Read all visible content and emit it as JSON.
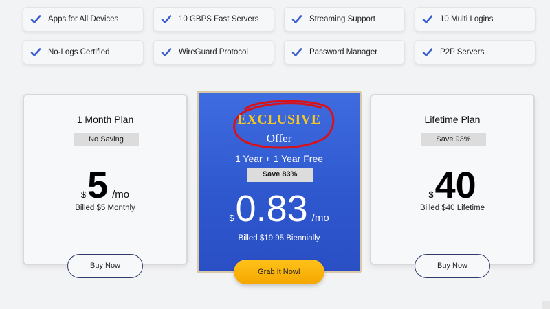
{
  "features": [
    {
      "label": "Apps for All Devices"
    },
    {
      "label": "10 GBPS Fast Servers"
    },
    {
      "label": "Streaming Support"
    },
    {
      "label": "10 Multi Logins"
    },
    {
      "label": "No-Logs Certified"
    },
    {
      "label": "WireGuard Protocol"
    },
    {
      "label": "Password Manager"
    },
    {
      "label": "P2P Servers"
    }
  ],
  "icons": {
    "feature": "checkmark-icon"
  },
  "colors": {
    "accent": "#3a5fcd",
    "featured_bg": "#3460d6",
    "cta": "#f8b410",
    "exclusive": "#f6c623",
    "annotation": "#d8121b"
  },
  "plans": {
    "monthly": {
      "title": "1 Month Plan",
      "badge": "No Saving",
      "currency": "$",
      "amount": "5",
      "period": "/mo",
      "billed": "Billed $5 Monthly",
      "button": "Buy Now"
    },
    "featured": {
      "exclusive": "EXCLUSIVE",
      "offer": "Offer",
      "deal": "1 Year + 1 Year Free",
      "badge": "Save 83%",
      "currency": "$",
      "amount": "0.83",
      "period": "/mo",
      "billed": "Billed $19.95 Biennially",
      "button": "Grab It Now!"
    },
    "lifetime": {
      "title": "Lifetime Plan",
      "badge": "Save 93%",
      "currency": "$",
      "amount": "40",
      "period": "",
      "billed": "Billed $40 Lifetime",
      "button": "Buy Now"
    }
  }
}
